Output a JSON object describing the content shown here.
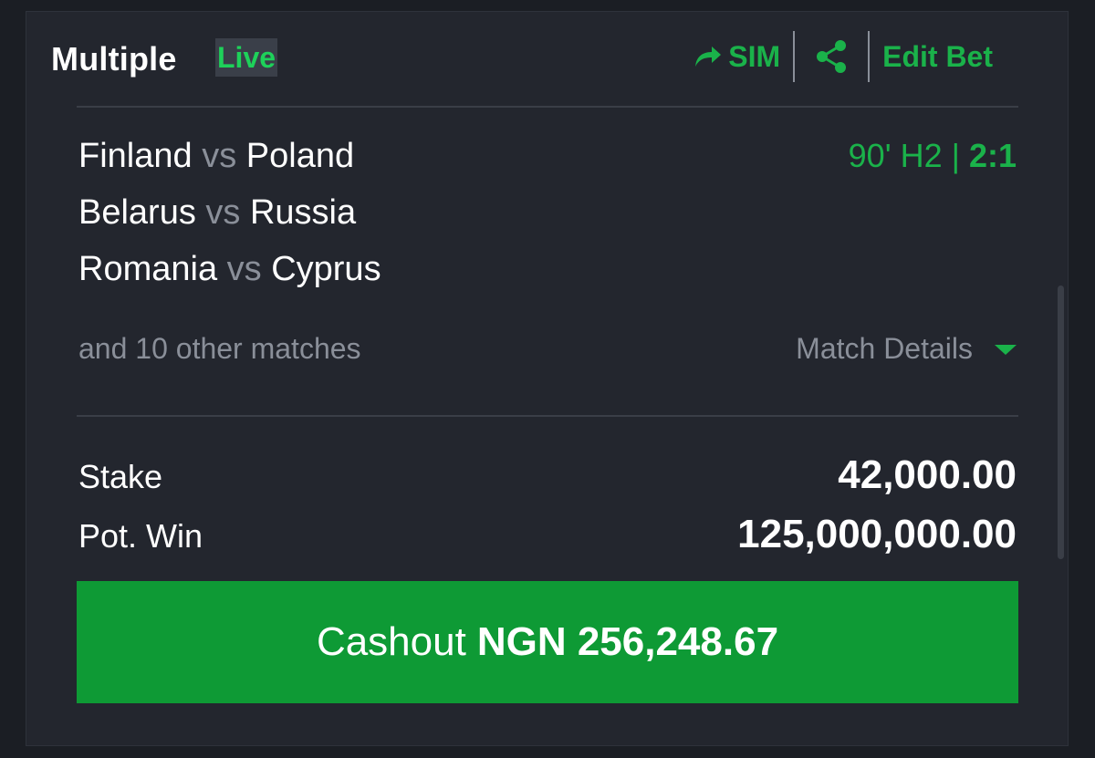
{
  "header": {
    "title": "Multiple",
    "live_badge": "Live",
    "sim_label": "SIM",
    "edit_label": "Edit Bet"
  },
  "matches": [
    {
      "home": "Finland",
      "vs": "vs",
      "away": "Poland"
    },
    {
      "home": "Belarus",
      "vs": "vs",
      "away": "Russia"
    },
    {
      "home": "Romania",
      "vs": "vs",
      "away": "Cyprus"
    }
  ],
  "live_status": {
    "time": "90' H2 |",
    "score": "2:1"
  },
  "others_text": "and 10 other matches",
  "match_details_label": "Match Details",
  "stake": {
    "label": "Stake",
    "value": "42,000.00"
  },
  "pot_win": {
    "label": "Pot. Win",
    "value": "125,000,000.00"
  },
  "cashout": {
    "label": "Cashout",
    "amount": "NGN 256,248.67"
  },
  "colors": {
    "accent_green": "#1ab24a",
    "cashout_button": "#0e9a35",
    "card_bg": "#23262e",
    "muted_text": "#8a8f99"
  },
  "icons": [
    "forward-arrow-icon",
    "share-icon",
    "caret-down-icon"
  ]
}
